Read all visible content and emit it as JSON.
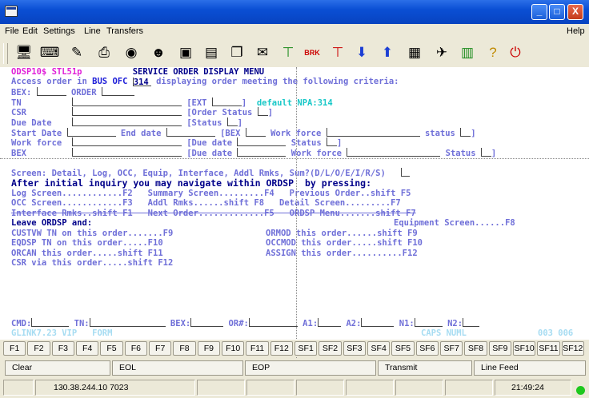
{
  "window": {
    "title": "",
    "minimize": "_",
    "maximize": "□",
    "close": "X"
  },
  "menu": {
    "file": "File",
    "edit": "Edit",
    "settings": "Settings",
    "line": "Line",
    "transfers": "Transfers",
    "help": "Help"
  },
  "screen": {
    "header_id": "ODSP10$ STL51p",
    "header_title": "SERVICE ORDER DISPLAY MENU",
    "access_pre": "Access order in ",
    "bus_ofc_label": "BUS OFC",
    "bus_ofc_value": "314",
    "access_post": " displaying order meeting the following criteria:",
    "bex_label": "BEX:",
    "order_label": "ORDER",
    "tn_label": "TN",
    "ext_label": "[EXT",
    "ext_close": "]",
    "default_label": "default",
    "npa_label": "NPA:",
    "npa_value": "314",
    "csr_label": "CSR",
    "order_status_label": "[Order Status",
    "due_date_label": "Due Date",
    "status_label": "[Status",
    "start_date_label": "Start Date",
    "end_date_label": "End date",
    "bex2_label": "[BEX",
    "work_force_label": "Work force",
    "status_lc_label": "status",
    "work_force2_label": "Work force",
    "due_date2_label": "[Due date",
    "status2_label": "Status",
    "bex3_label": "BEX",
    "due_date3_label": "[Due date",
    "work_force3_label": "Work force",
    "status3_label": "Status",
    "screen_line": "Screen: Detail, Log, OCC, Equip, Interface, Addl Rmks, Sum?(D/L/O/E/I/R/S)",
    "nav_line": "After initial inquiry you may navigate within ORDSP  by pressing:",
    "r1": "Log Screen............F2   Summary Screen.........F4   Previous Order..shift F5",
    "r2": "OCC Screen............F3   Addl Rmks......shift F8   Detail Screen.........F7",
    "r3": "Interface Rmks..shift F1   Next Order.............F5   ORDSP Menu.......shift F7",
    "leave_line": "Leave ORDSP and:",
    "equip_line": "Equipment Screen......F8",
    "l1a": "CUSTVW TN on this order.......F9",
    "l1b": "ORMOD this order......shift F9",
    "l2a": "EQDSP TN on this order.....F10",
    "l2b": "OCCMOD this order.....shift F10",
    "l3a": "ORCAN this order.....shift F11",
    "l3b": "ASSIGN this order..........F12",
    "l4a": "CSR via this order.....shift F12",
    "cmd_label": "CMD:",
    "tn2_label": "TN:",
    "bex4_label": "BEX:",
    "or_label": "OR#:",
    "a1_label": "A1:",
    "a2_label": "A2:",
    "n1_label": "N1:",
    "n2_label": "N2:",
    "oia_left": "GLINK7.23 VIP   FORM",
    "oia_mid": "CAPS NUML",
    "oia_right": "003 006"
  },
  "fkeys": [
    "F1",
    "F2",
    "F3",
    "F4",
    "F5",
    "F6",
    "F7",
    "F8",
    "F9",
    "F10",
    "F11",
    "F12",
    "SF1",
    "SF2",
    "SF3",
    "SF4",
    "SF5",
    "SF6",
    "SF7",
    "SF8",
    "SF9",
    "SF10",
    "SF11",
    "SF12"
  ],
  "actions": {
    "clear": "Clear",
    "eol": "EOL",
    "eop": "EOP",
    "transmit": "Transmit",
    "line_feed": "Line Feed"
  },
  "status": {
    "host": "130.38.244.10 7023",
    "time": "21:49:24"
  },
  "icons": [
    "screen-icon",
    "keyboard-icon",
    "wand-icon",
    "printer-icon",
    "camera-icon",
    "agent-icon",
    "window-icon",
    "notes-icon",
    "copy-icon",
    "stamp-icon",
    "antenna-icon",
    "break-icon",
    "send-icon",
    "down-arrow-icon",
    "up-arrow-icon",
    "calendar-icon",
    "satellite-icon",
    "keypad-icon",
    "help-icon",
    "exit-icon"
  ]
}
